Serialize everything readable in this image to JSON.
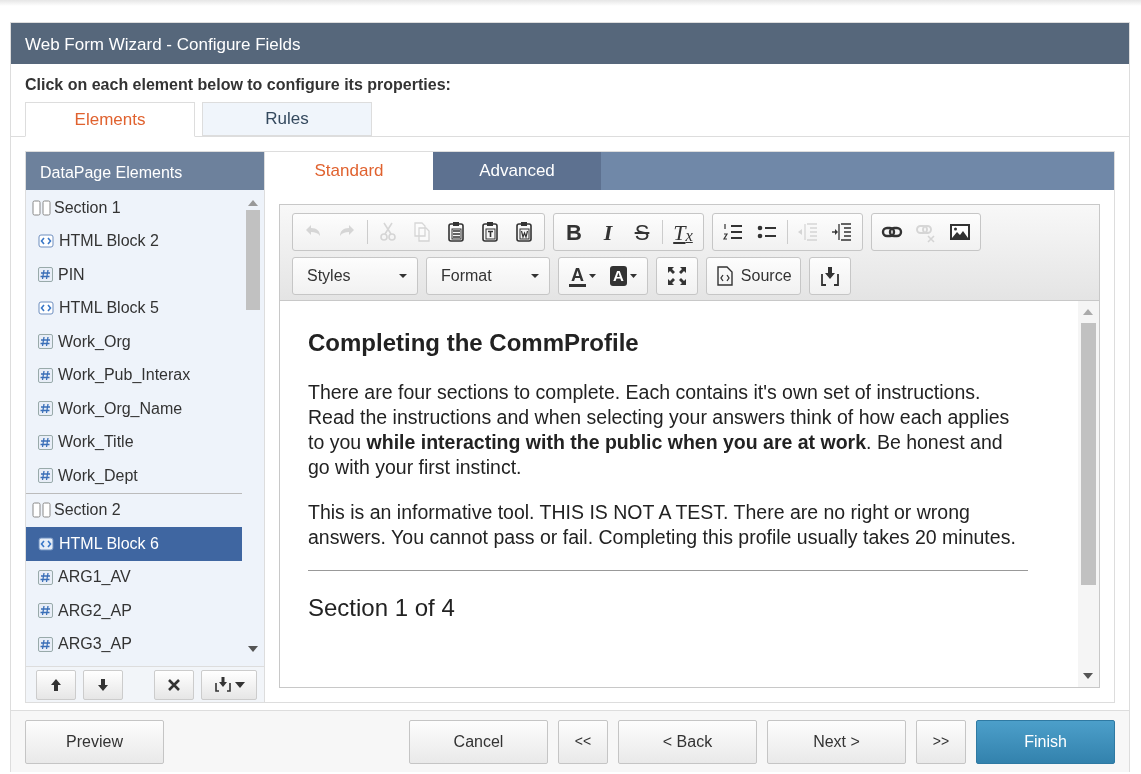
{
  "window": {
    "title": "Web Form Wizard - Configure Fields"
  },
  "instruction": "Click on each element below to configure its properties:",
  "tabs": [
    {
      "label": "Elements",
      "selected": true
    },
    {
      "label": "Rules",
      "selected": false
    }
  ],
  "elements_panel": {
    "title": "DataPage Elements",
    "items": [
      {
        "kind": "section",
        "label": "Section 1",
        "selected": false,
        "children": [
          {
            "kind": "html",
            "label": "HTML Block 2",
            "selected": false
          },
          {
            "kind": "field",
            "label": "PIN",
            "selected": false
          },
          {
            "kind": "html",
            "label": "HTML Block 5",
            "selected": false
          },
          {
            "kind": "field",
            "label": "Work_Org",
            "selected": false
          },
          {
            "kind": "field",
            "label": "Work_Pub_Interax",
            "selected": false
          },
          {
            "kind": "field",
            "label": "Work_Org_Name",
            "selected": false
          },
          {
            "kind": "field",
            "label": "Work_Title",
            "selected": false
          },
          {
            "kind": "field",
            "label": "Work_Dept",
            "selected": false
          }
        ]
      },
      {
        "kind": "section",
        "label": "Section 2",
        "selected": false,
        "children": [
          {
            "kind": "html",
            "label": "HTML Block 6",
            "selected": true
          },
          {
            "kind": "field",
            "label": "ARG1_AV",
            "selected": false
          },
          {
            "kind": "field",
            "label": "ARG2_AP",
            "selected": false
          },
          {
            "kind": "field",
            "label": "ARG3_AP",
            "selected": false
          }
        ]
      }
    ],
    "buttons": [
      {
        "kind": "up"
      },
      {
        "kind": "down"
      },
      {
        "kind": "delete"
      },
      {
        "kind": "insert"
      }
    ]
  },
  "property_tabs": [
    {
      "label": "Standard",
      "selected": true
    },
    {
      "label": "Advanced",
      "selected": false
    }
  ],
  "toolbar": {
    "rows": [
      {
        "groups": [
          {
            "items": [
              {
                "kind": "undo",
                "disabled": true
              },
              {
                "kind": "redo",
                "disabled": true
              },
              {
                "kind": "sep"
              },
              {
                "kind": "cut",
                "disabled": true
              },
              {
                "kind": "copy",
                "disabled": true
              },
              {
                "kind": "paste",
                "disabled": false
              },
              {
                "kind": "paste-text",
                "disabled": false
              },
              {
                "kind": "paste-word",
                "disabled": false
              }
            ]
          },
          {
            "items": [
              {
                "kind": "bold",
                "text": "B",
                "disabled": false
              },
              {
                "kind": "italic",
                "text": "I",
                "disabled": false
              },
              {
                "kind": "strike",
                "text": "S",
                "disabled": false
              },
              {
                "kind": "sep"
              },
              {
                "kind": "clear-format",
                "text": "T$_{x}$",
                "disabled": false
              }
            ]
          },
          {
            "items": [
              {
                "kind": "numbered-list",
                "disabled": false
              },
              {
                "kind": "bullet-list",
                "disabled": false
              },
              {
                "kind": "sep"
              },
              {
                "kind": "outdent",
                "disabled": true
              },
              {
                "kind": "indent",
                "disabled": false
              }
            ]
          },
          {
            "items": [
              {
                "kind": "link",
                "disabled": false
              },
              {
                "kind": "unlink",
                "disabled": true
              },
              {
                "kind": "image",
                "disabled": false
              }
            ]
          }
        ]
      },
      {
        "groups": [
          {
            "items": [
              {
                "kind": "styles",
                "text": "Styles"
              }
            ]
          },
          {
            "items": [
              {
                "kind": "format",
                "text": "Format"
              }
            ]
          },
          {
            "items": [
              {
                "kind": "text-color",
                "text": "A"
              },
              {
                "kind": "bg-color",
                "text": "A"
              }
            ]
          },
          {
            "items": [
              {
                "kind": "maximize"
              }
            ]
          },
          {
            "items": [
              {
                "kind": "source",
                "text": "Source"
              }
            ]
          },
          {
            "items": [
              {
                "kind": "insert"
              }
            ]
          }
        ]
      }
    ]
  },
  "content": [
    {
      "kind": "heading",
      "text": "Completing the CommProfile"
    },
    {
      "kind": "paragraph",
      "text": "There are four sections to complete. Each contains it's own set of instructions. Read the instructions and when selecting your answers think of how each applies to you **while interacting with the public when you are at work**. Be honest and go with your first instinct."
    },
    {
      "kind": "paragraph",
      "text": "This is an informative tool. THIS IS NOT A TEST. There are no right or wrong answers. You cannot pass or fail. Completing this profile usually takes 20 minutes."
    },
    {
      "kind": "rule"
    },
    {
      "kind": "subheading",
      "text": "Section 1 of 4"
    }
  ],
  "footer": {
    "buttons": [
      {
        "label": "Preview",
        "kind": "normal"
      },
      {
        "label": "Cancel",
        "kind": "normal"
      },
      {
        "label": "<<",
        "kind": "small"
      },
      {
        "label": "< Back",
        "kind": "normal"
      },
      {
        "label": "Next >",
        "kind": "normal"
      },
      {
        "label": ">>",
        "kind": "small"
      },
      {
        "label": "Finish",
        "kind": "primary"
      }
    ]
  }
}
